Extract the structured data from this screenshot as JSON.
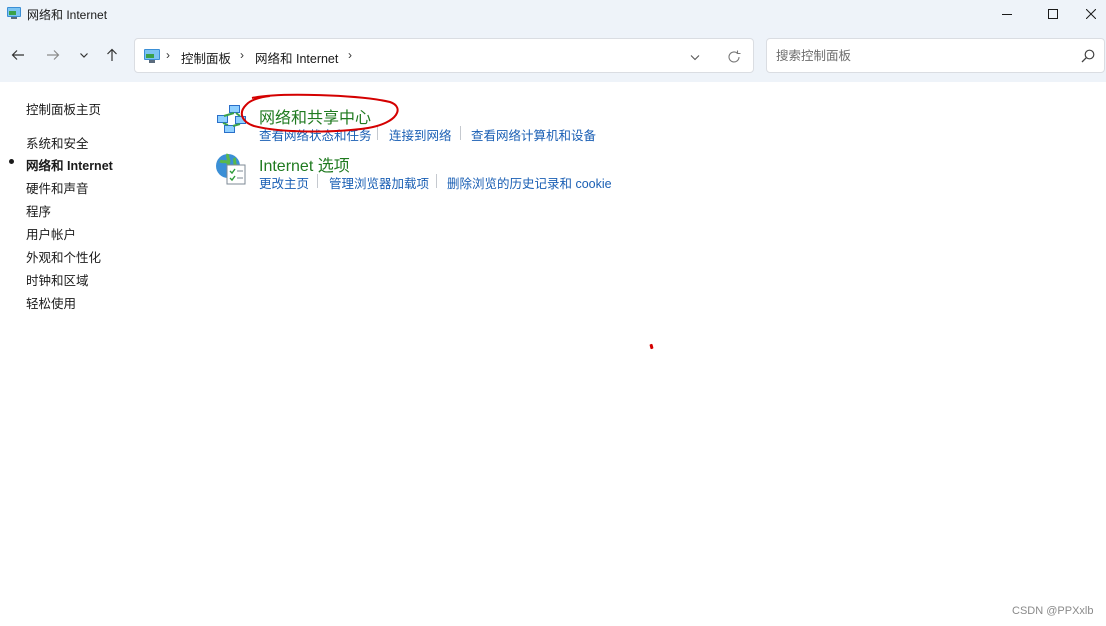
{
  "window": {
    "title": "网络和 Internet",
    "icon": "control-panel-icon",
    "buttons": [
      "minimize-icon",
      "maximize-icon",
      "close-icon"
    ]
  },
  "navigation": {
    "icons": [
      "arrow-left-icon",
      "arrow-right-icon",
      "chevron-down-icon",
      "arrow-up-icon"
    ]
  },
  "address": {
    "icon": "control-panel-icon",
    "crumbs": [
      "控制面板",
      "网络和 Internet"
    ],
    "separator": "›",
    "icons": [
      "chevron-down-icon",
      "refresh-icon"
    ]
  },
  "search": {
    "placeholder": "搜索控制面板",
    "value": "",
    "icon": "search-icon"
  },
  "sidebar": {
    "items": [
      {
        "label": "控制面板主页",
        "active": false
      },
      {
        "label": "系统和安全",
        "active": false
      },
      {
        "label": "网络和 Internet",
        "active": true
      },
      {
        "label": "硬件和声音",
        "active": false
      },
      {
        "label": "程序",
        "active": false
      },
      {
        "label": "用户帐户",
        "active": false
      },
      {
        "label": "外观和个性化",
        "active": false
      },
      {
        "label": "时钟和区域",
        "active": false
      },
      {
        "label": "轻松使用",
        "active": false
      }
    ]
  },
  "main": {
    "categories": [
      {
        "title": "网络和共享中心",
        "icon": "network-sharing-icon",
        "links": [
          "查看网络状态和任务",
          "连接到网络",
          "查看网络计算机和设备"
        ]
      },
      {
        "title": "Internet 选项",
        "icon": "internet-options-icon",
        "links": [
          "更改主页",
          "管理浏览器加载项",
          "删除浏览的历史记录和 cookie"
        ]
      }
    ]
  },
  "colors": {
    "title_green": "#1f7a1f",
    "link_blue": "#1a5fb4",
    "annotation_red": "#d40000",
    "chrome_bg": "#eef3f9"
  },
  "watermark": "CSDN @PPXxlb"
}
